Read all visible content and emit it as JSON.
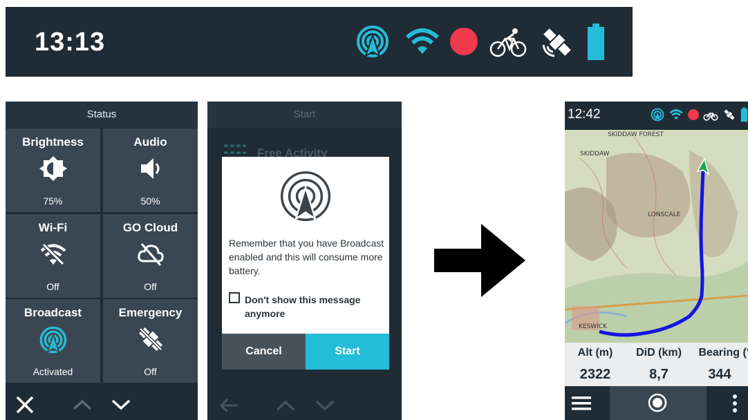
{
  "topbar": {
    "time": "13:13"
  },
  "status_panel": {
    "title": "Status",
    "tiles": [
      {
        "title": "Brightness",
        "value": "75%",
        "icon": "brightness-icon"
      },
      {
        "title": "Audio",
        "value": "50%",
        "icon": "speaker-icon"
      },
      {
        "title": "Wi-Fi",
        "value": "Off",
        "icon": "wifi-off-icon"
      },
      {
        "title": "GO Cloud",
        "value": "Off",
        "icon": "cloud-off-icon"
      },
      {
        "title": "Broadcast",
        "value": "Activated",
        "icon": "broadcast-icon"
      },
      {
        "title": "Emergency",
        "value": "Off",
        "icon": "emergency-off-icon"
      }
    ]
  },
  "start_panel": {
    "title": "Start",
    "background_item": "Free Activity",
    "dialog": {
      "message": "Remember that you have Broadcast enabled and this will consume more battery.",
      "checkbox_label": "Don't show this message anymore",
      "checkbox_checked": false,
      "cancel_label": "Cancel",
      "start_label": "Start"
    }
  },
  "device": {
    "time": "12:42",
    "map_labels": [
      "SKIDDAW FOREST",
      "SKIDDAW",
      "LONSCALE",
      "KESWICK"
    ],
    "stats": [
      {
        "label": "Alt (m)",
        "value": "2322"
      },
      {
        "label": "DiD (km)",
        "value": "8,7"
      },
      {
        "label": "Bearing (°)",
        "value": "344"
      }
    ]
  },
  "colors": {
    "panel_bg": "#1f2b35",
    "tile_bg": "#3a4752",
    "accent_cyan": "#24bcd8",
    "record_red": "#f0394d",
    "route_blue": "#1414e0"
  }
}
